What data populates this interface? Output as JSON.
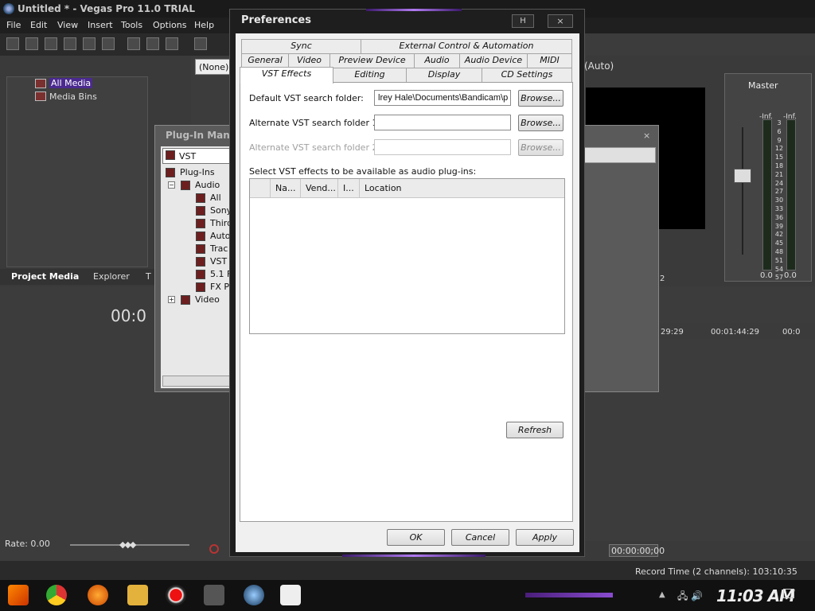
{
  "app": {
    "title": "Untitled * - Vegas Pro 11.0 TRIAL",
    "menu": [
      "File",
      "Edit",
      "View",
      "Insert",
      "Tools",
      "Options",
      "Help"
    ],
    "none_selector": "(None)",
    "explorer": {
      "all_media": "All Media",
      "media_bins": "Media Bins"
    },
    "window_tabs": {
      "project_media": "Project Media",
      "explorer": "Explorer",
      "third": "T"
    },
    "time_display": "00:0",
    "rate": "Rate: 0.00",
    "preview_quality": "(Auto)",
    "mixer": {
      "label": "Master",
      "left_top": "-Inf.",
      "right_top": "-Inf.",
      "scale": [
        "3",
        "6",
        "9",
        "12",
        "15",
        "18",
        "21",
        "24",
        "27",
        "30",
        "33",
        "36",
        "39",
        "42",
        "45",
        "48",
        "51",
        "54",
        "57"
      ],
      "left_bottom": "0.0",
      "right_bottom": "0.0"
    },
    "ruler": [
      "29:29",
      "00:01:44:29",
      "00:0"
    ],
    "marker_num": "2",
    "time_field": "00:00:00;00",
    "record_time": "Record Time (2 channels): 103:10:35"
  },
  "plugin_manager": {
    "title": "Plug-In Manag",
    "selector": "VST",
    "tree": [
      {
        "label": "Plug-Ins",
        "depth": 0
      },
      {
        "label": "Audio",
        "depth": 1,
        "expander": "−"
      },
      {
        "label": "All",
        "depth": 2
      },
      {
        "label": "Sony",
        "depth": 2
      },
      {
        "label": "Third",
        "depth": 2
      },
      {
        "label": "Auto",
        "depth": 2
      },
      {
        "label": "Trac",
        "depth": 2
      },
      {
        "label": "VST",
        "depth": 2
      },
      {
        "label": "5.1 F",
        "depth": 2
      },
      {
        "label": "FX Pa",
        "depth": 2
      },
      {
        "label": "Video",
        "depth": 1,
        "expander": "+"
      }
    ],
    "close": "×"
  },
  "dialog": {
    "title": "Preferences",
    "title_buttons": {
      "help": "H",
      "close": "×"
    },
    "tabs_row1": [
      "Sync",
      "External Control & Automation"
    ],
    "tabs_row2": [
      "General",
      "Video",
      "Preview Device",
      "Audio",
      "Audio Device",
      "MIDI"
    ],
    "tabs_row3": [
      "VST Effects",
      "Editing",
      "Display",
      "CD Settings"
    ],
    "active_tab": "VST Effects",
    "default_folder_label": "Default VST search folder:",
    "default_folder_value": "lrey Hale\\Documents\\Bandicam\\p",
    "alt1_label": "Alternate VST search folder 1:",
    "alt1_value": "",
    "alt2_label": "Alternate VST search folder 2:",
    "alt2_value": "",
    "browse": "Browse...",
    "list_label": "Select VST effects to be available as audio plug-ins:",
    "columns": [
      "Na...",
      "Vend...",
      "I...",
      "Location"
    ],
    "refresh": "Refresh",
    "ok": "OK",
    "cancel": "Cancel",
    "apply": "Apply"
  },
  "taskbar": {
    "clock": "11:03 AM"
  }
}
